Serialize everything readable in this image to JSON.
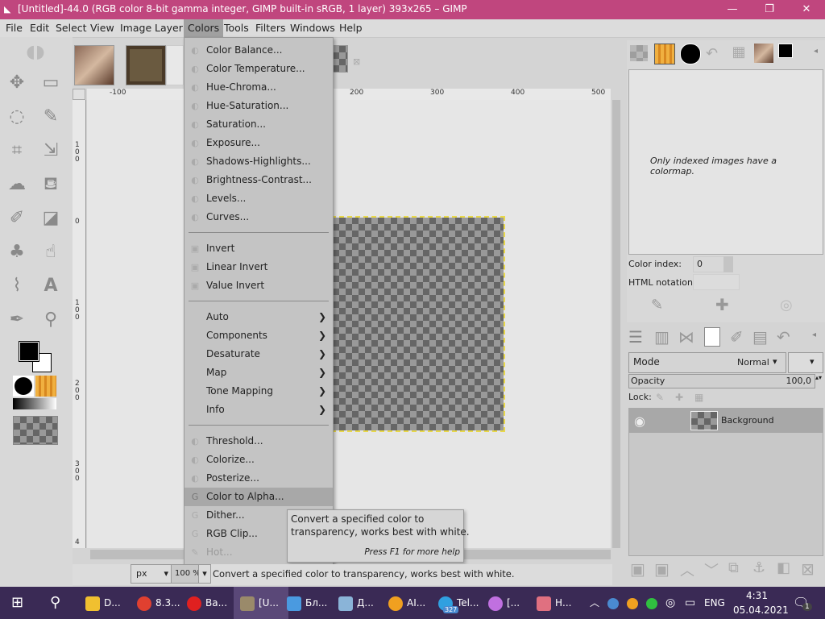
{
  "window": {
    "title": "[Untitled]-44.0 (RGB color 8-bit gamma integer, GIMP built-in sRGB, 1 layer) 393x265 – GIMP",
    "minimize": "—",
    "maximize": "❐",
    "close": "✕"
  },
  "menubar": {
    "items": [
      "File",
      "Edit",
      "Select",
      "View",
      "Image",
      "Layer",
      "Colors",
      "Tools",
      "Filters",
      "Windows",
      "Help"
    ]
  },
  "colors_menu": {
    "group1": [
      "Color Balance...",
      "Color Temperature...",
      "Hue-Chroma...",
      "Hue-Saturation...",
      "Saturation...",
      "Exposure...",
      "Shadows-Highlights...",
      "Brightness-Contrast...",
      "Levels...",
      "Curves..."
    ],
    "group2": [
      "Invert",
      "Linear Invert",
      "Value Invert"
    ],
    "group3": [
      "Auto",
      "Components",
      "Desaturate",
      "Map",
      "Tone Mapping",
      "Info"
    ],
    "group4": [
      "Threshold...",
      "Colorize...",
      "Posterize...",
      "Color to Alpha...",
      "Dither...",
      "RGB Clip...",
      "Hot..."
    ],
    "selected": "Color to Alpha..."
  },
  "tooltip": {
    "line1": "Convert a specified color to",
    "line2": "transparency, works best with white.",
    "help": "Press F1 for more help"
  },
  "rulers": {
    "top": [
      "-100",
      "200",
      "300",
      "400",
      "500"
    ],
    "left": [
      "100",
      "0",
      "100",
      "200",
      "300",
      "4"
    ]
  },
  "colormap": {
    "message": "Only indexed images have a colormap.",
    "color_index_label": "Color index:",
    "color_index_value": "0",
    "html_notation_label": "HTML notation:"
  },
  "layers": {
    "mode_label": "Mode",
    "mode_value": "Normal",
    "opacity_label": "Opacity",
    "opacity_value": "100,0",
    "lock_label": "Lock:",
    "layer_name": "Background"
  },
  "statusbar": {
    "unit": "px",
    "zoom": "100 %",
    "message": "Convert a specified color to transparency, works best with white."
  },
  "taskbar": {
    "apps": [
      "D...",
      "8.3...",
      "Ва...",
      "[U...",
      "Бл...",
      "Д...",
      "AI...",
      "Tel...",
      "[...",
      "Н..."
    ],
    "telegram_badge": "327",
    "lang": "ENG",
    "time": "4:31",
    "date": "05.04.2021",
    "notifications": "1"
  },
  "colors": {
    "titlebar": "#c0467e",
    "taskbar": "#3a2a55",
    "selection_border": "#e8d84a"
  }
}
